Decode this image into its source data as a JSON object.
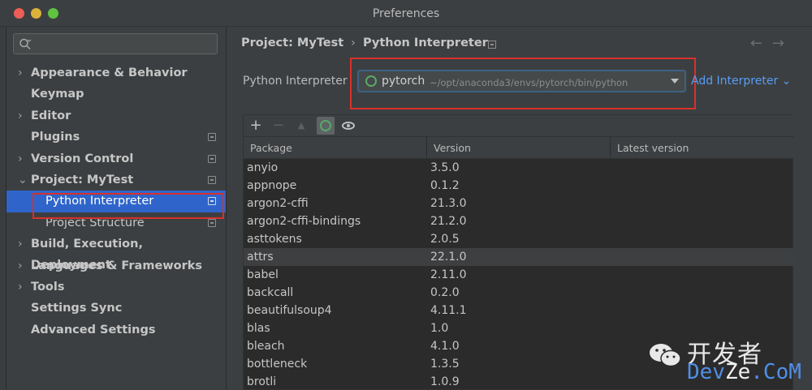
{
  "window": {
    "title": "Preferences"
  },
  "sidebar": {
    "search_placeholder": "",
    "items": [
      {
        "label": "Appearance & Behavior",
        "chevron": "›",
        "has_icon": false
      },
      {
        "label": "Keymap",
        "chevron": "",
        "has_icon": false
      },
      {
        "label": "Editor",
        "chevron": "›",
        "has_icon": false
      },
      {
        "label": "Plugins",
        "chevron": "",
        "has_icon": true
      },
      {
        "label": "Version Control",
        "chevron": "›",
        "has_icon": true
      },
      {
        "label": "Project: MyTest",
        "chevron": "⌄",
        "has_icon": true
      },
      {
        "label": "Python Interpreter",
        "chevron": "",
        "has_icon": true,
        "selected": true,
        "child": true
      },
      {
        "label": "Project Structure",
        "chevron": "",
        "has_icon": true,
        "child": true
      },
      {
        "label": "Build, Execution, Deployment",
        "chevron": "›",
        "has_icon": false
      },
      {
        "label": "Languages & Frameworks",
        "chevron": "›",
        "has_icon": false
      },
      {
        "label": "Tools",
        "chevron": "›",
        "has_icon": false
      },
      {
        "label": "Settings Sync",
        "chevron": "",
        "has_icon": false
      },
      {
        "label": "Advanced Settings",
        "chevron": "",
        "has_icon": false
      }
    ]
  },
  "breadcrumb": {
    "project": "Project: MyTest",
    "separator": "›",
    "page": "Python Interpreter",
    "back": "←",
    "forward": "→"
  },
  "interpreter": {
    "label": "Python Interpreter",
    "name": "pytorch",
    "path": "~/opt/anaconda3/envs/pytorch/bin/python",
    "add_label": "Add Interpreter ⌄"
  },
  "toolbar": {
    "add": "+",
    "remove": "−",
    "up": "▲"
  },
  "table": {
    "columns": [
      "Package",
      "Version",
      "Latest version"
    ],
    "rows": [
      [
        "anyio",
        "3.5.0",
        ""
      ],
      [
        "appnope",
        "0.1.2",
        ""
      ],
      [
        "argon2-cffi",
        "21.3.0",
        ""
      ],
      [
        "argon2-cffi-bindings",
        "21.2.0",
        ""
      ],
      [
        "asttokens",
        "2.0.5",
        ""
      ],
      [
        "attrs",
        "22.1.0",
        ""
      ],
      [
        "babel",
        "2.11.0",
        ""
      ],
      [
        "backcall",
        "0.2.0",
        ""
      ],
      [
        "beautifulsoup4",
        "4.11.1",
        ""
      ],
      [
        "blas",
        "1.0",
        ""
      ],
      [
        "bleach",
        "4.1.0",
        ""
      ],
      [
        "bottleneck",
        "1.3.5",
        ""
      ],
      [
        "brotli",
        "1.0.9",
        ""
      ]
    ]
  },
  "watermark": {
    "cn": "开发者",
    "en_a": "Dev",
    "en_b": "Ze",
    "en_c": ".CoM"
  },
  "colors": {
    "selection": "#2f65ca",
    "highlight_box": "#d9302b",
    "link": "#589df6",
    "ring": "#59a869"
  }
}
